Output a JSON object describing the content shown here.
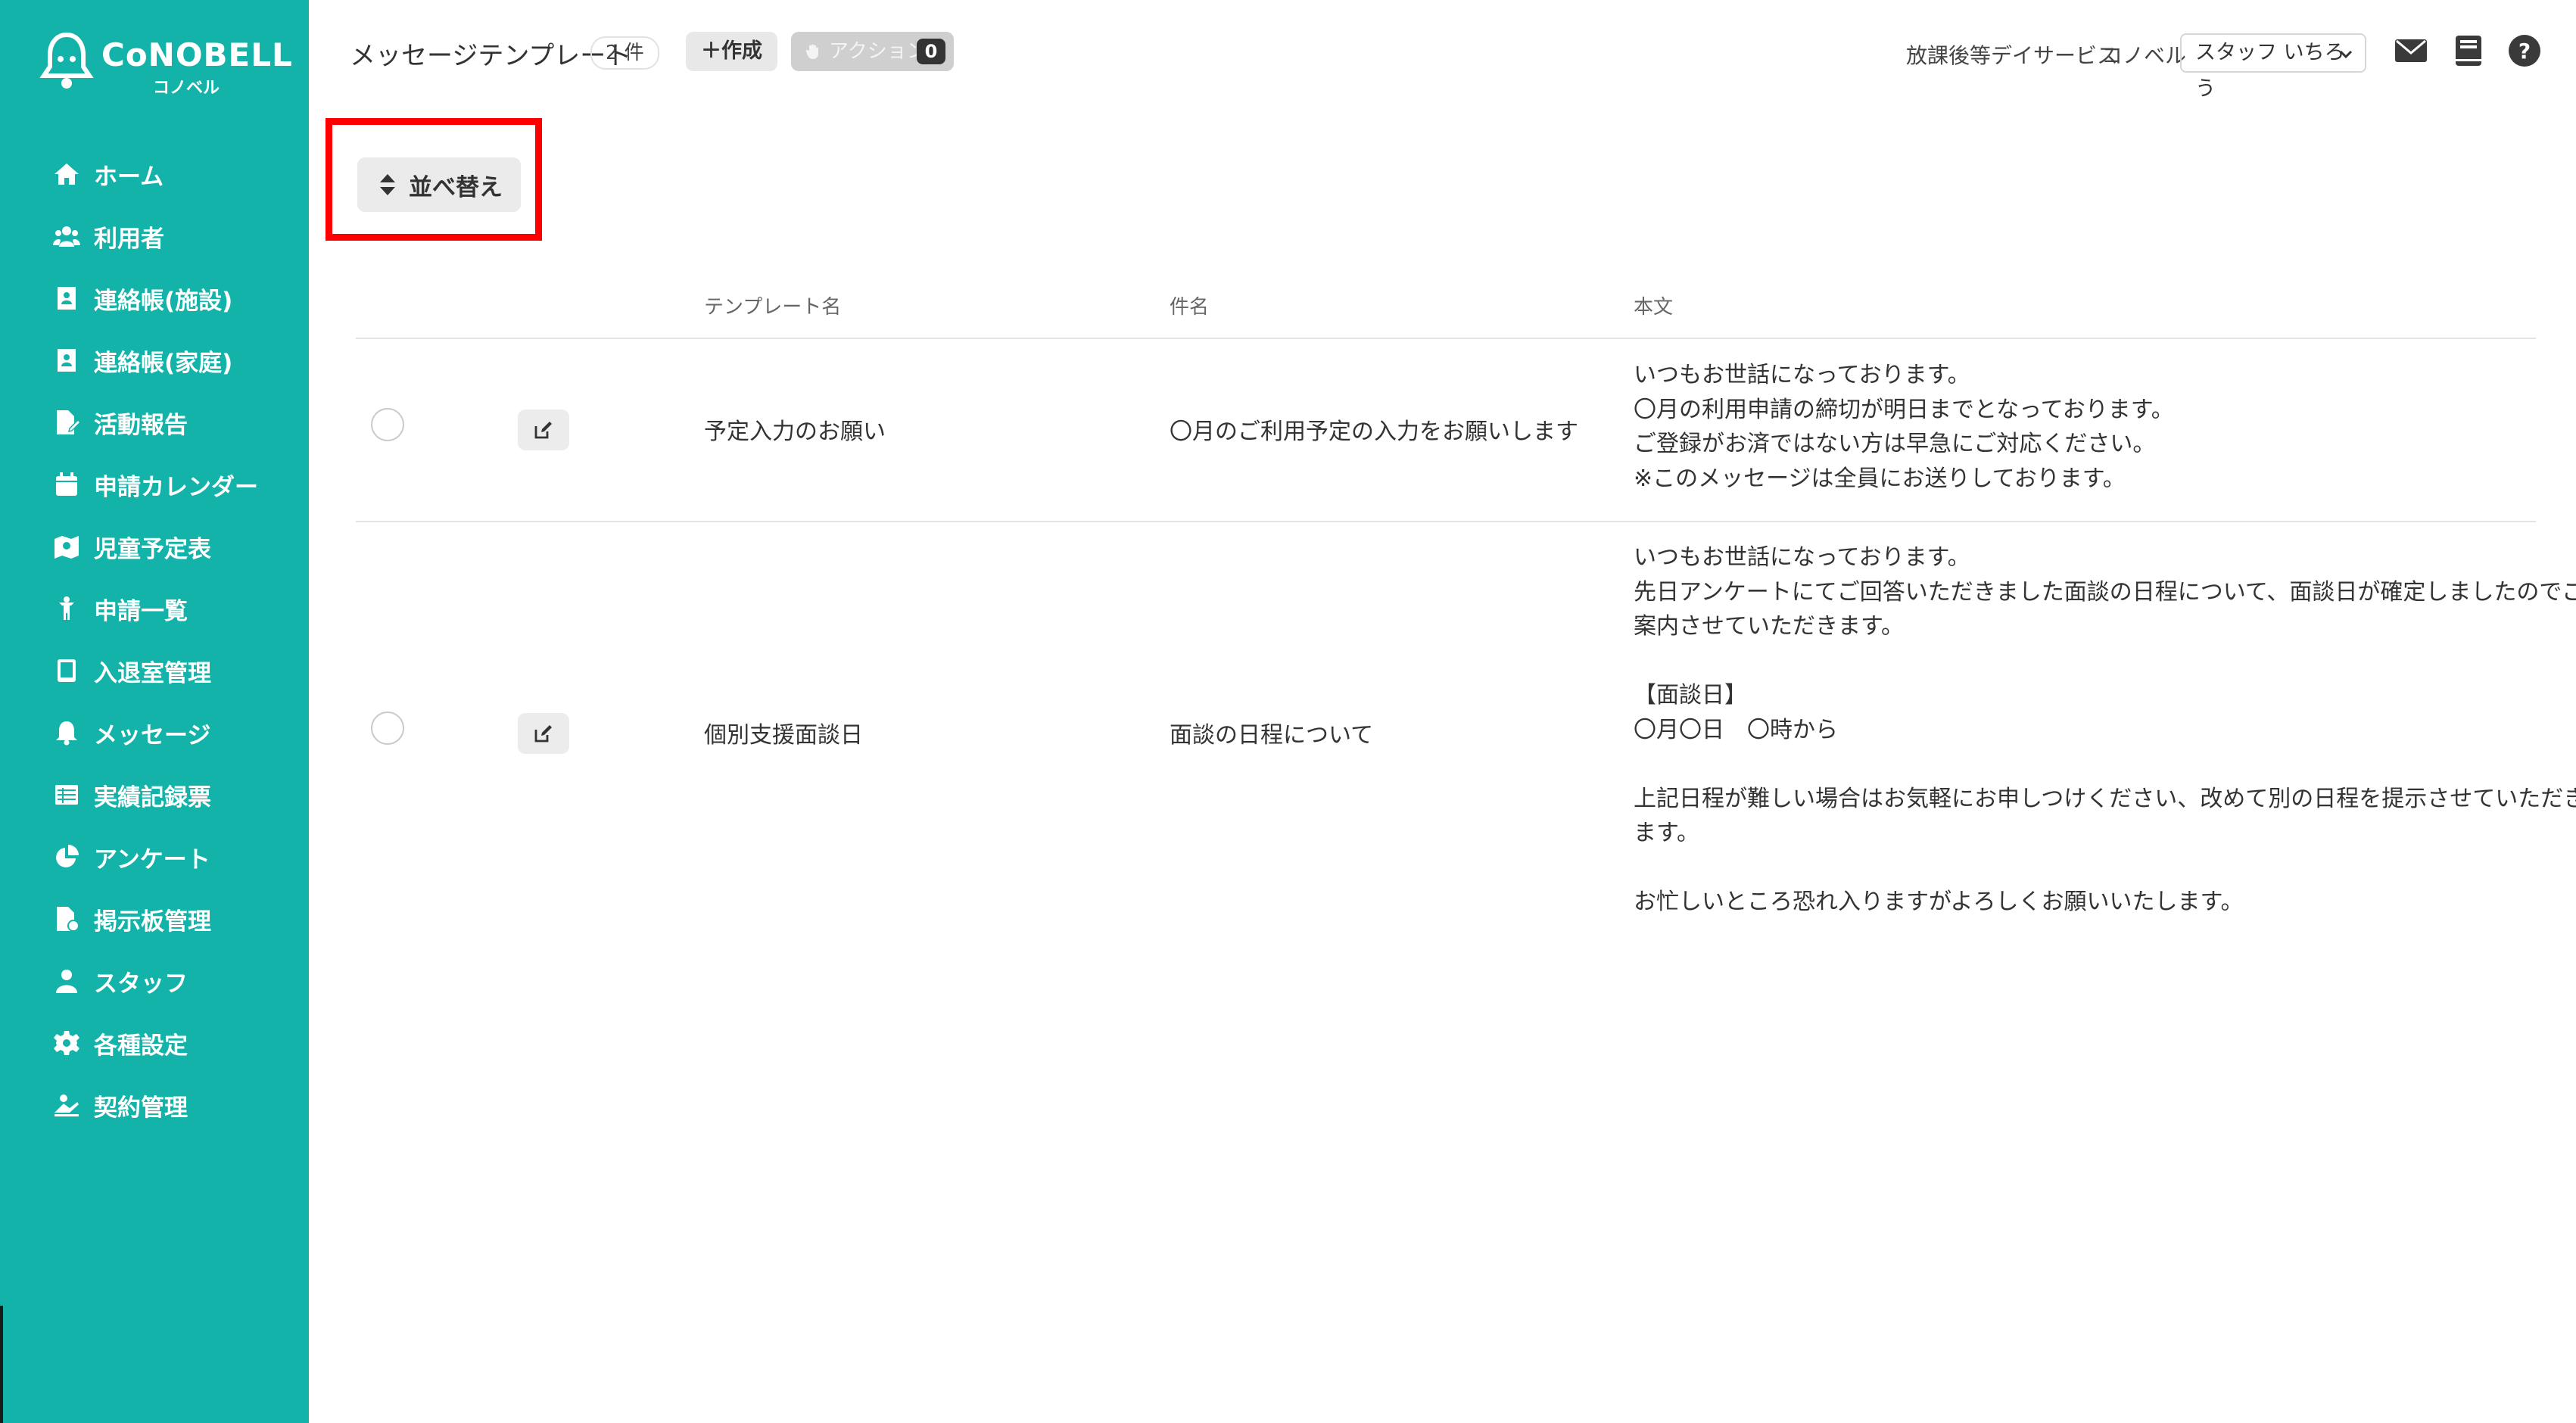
{
  "sidebar": {
    "brand": "CoNOBELL",
    "brand_kana": "コノベル",
    "items": [
      {
        "label": "ホーム",
        "icon": "home-icon"
      },
      {
        "label": "利用者",
        "icon": "users-icon"
      },
      {
        "label": "連絡帳(施設)",
        "icon": "contact-book-icon"
      },
      {
        "label": "連絡帳(家庭)",
        "icon": "contact-book-icon"
      },
      {
        "label": "活動報告",
        "icon": "report-icon"
      },
      {
        "label": "申請カレンダー",
        "icon": "calendar-icon"
      },
      {
        "label": "児童予定表",
        "icon": "schedule-icon"
      },
      {
        "label": "申請一覧",
        "icon": "child-icon"
      },
      {
        "label": "入退室管理",
        "icon": "tablet-icon"
      },
      {
        "label": "メッセージ",
        "icon": "bell-icon"
      },
      {
        "label": "実績記録票",
        "icon": "table-icon"
      },
      {
        "label": "アンケート",
        "icon": "pie-chart-icon"
      },
      {
        "label": "掲示板管理",
        "icon": "board-icon"
      },
      {
        "label": "スタッフ",
        "icon": "staff-icon"
      },
      {
        "label": "各種設定",
        "icon": "gear-icon"
      },
      {
        "label": "契約管理",
        "icon": "contract-icon"
      }
    ],
    "colors": {
      "background": "#14b3aa",
      "text": "#ffffff"
    }
  },
  "header": {
    "title": "メッセージテンプレート",
    "count": "2 件",
    "create_label": "作成",
    "action_label": "アクション",
    "action_count": "0",
    "facility": "放課後等デイサービス",
    "company": "コノベル",
    "staff_selected": "スタッフ いちろう"
  },
  "toolbar": {
    "sort_label": "並べ替え",
    "highlight_color": "#ff0000"
  },
  "table": {
    "columns": [
      "テンプレート名",
      "件名",
      "本文"
    ],
    "rows": [
      {
        "name": "予定入力のお願い",
        "subject": "〇月のご利用予定の入力をお願いします",
        "body": [
          "いつもお世話になっております。",
          "〇月の利用申請の締切が明日までとなっております。",
          "ご登録がお済ではない方は早急にご対応ください。",
          "※このメッセージは全員にお送りしております。"
        ]
      },
      {
        "name": "個別支援面談日",
        "subject": "面談の日程について",
        "body": [
          "いつもお世話になっております。",
          "先日アンケートにてご回答いただきました面談の日程について、面談日が確定しましたのでご",
          "案内させていただきます。",
          "",
          "【面談日】",
          "〇月〇日　〇時から",
          "",
          "上記日程が難しい場合はお気軽にお申しつけください、改めて別の日程を提示させていただき",
          "ます。",
          "",
          "お忙しいところ恐れ入りますがよろしくお願いいたします。"
        ]
      }
    ]
  }
}
